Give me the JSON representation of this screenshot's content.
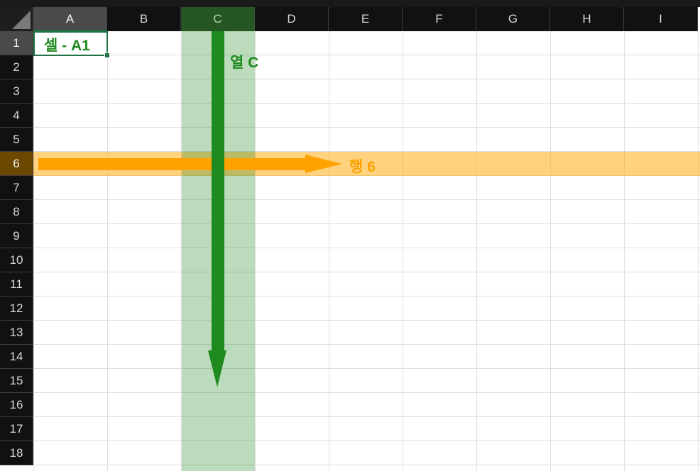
{
  "grid": {
    "columns": [
      "A",
      "B",
      "C",
      "D",
      "E",
      "F",
      "G",
      "H",
      "I"
    ],
    "rows": [
      "1",
      "2",
      "3",
      "4",
      "5",
      "6",
      "7",
      "8",
      "9",
      "10",
      "11",
      "12",
      "13",
      "14",
      "15",
      "16",
      "17",
      "18"
    ],
    "selected_cell": "A1",
    "highlighted_column": "C",
    "highlighted_row": "6"
  },
  "annotations": {
    "cell_label": "셀 - A1",
    "column_label": "열 C",
    "row_label": "행 6"
  },
  "colors": {
    "header_background": "#111111",
    "header_text": "#d6d6d6",
    "gridline": "#dedede",
    "selection_border": "#217346",
    "column_highlight": "#2e8b2e",
    "column_arrow": "#1f8a1f",
    "row_highlight": "#ffa500",
    "row_arrow": "#ffa200"
  },
  "icons": {
    "select_all": "select-all-triangle-icon"
  }
}
